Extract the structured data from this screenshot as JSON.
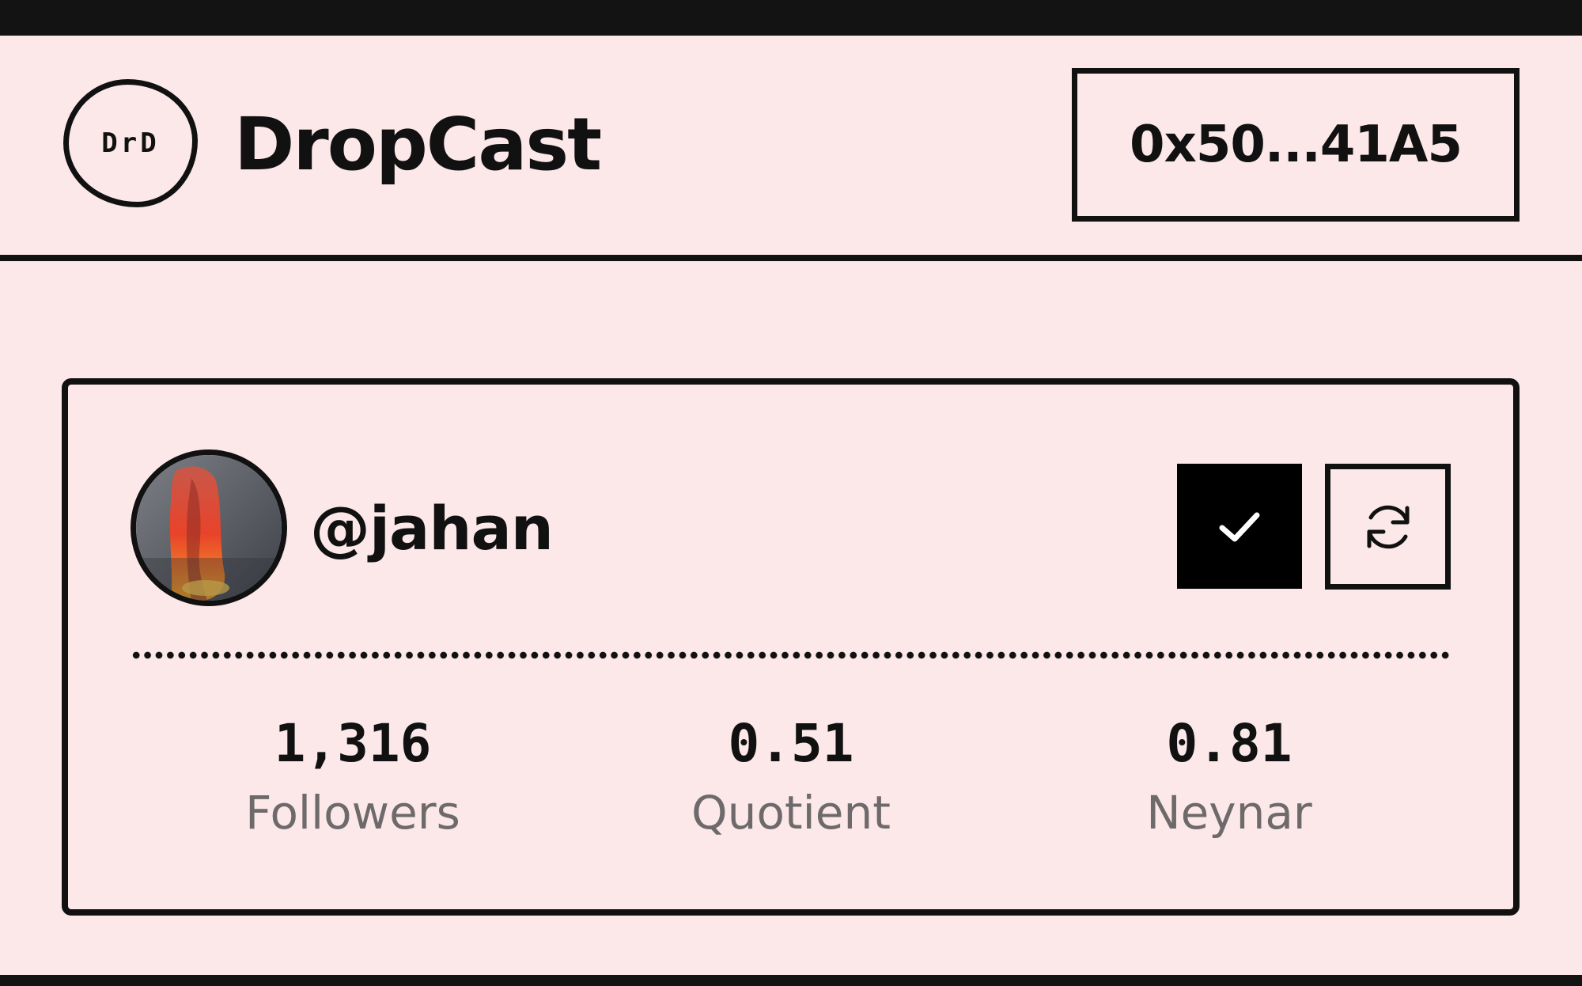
{
  "brand": {
    "logo_text": "DrD",
    "name": "DropCast"
  },
  "wallet": {
    "address": "0x50...41A5"
  },
  "profile": {
    "username": "@jahan",
    "stats": [
      {
        "value": "1,316",
        "label": "Followers"
      },
      {
        "value": "0.51",
        "label": "Quotient"
      },
      {
        "value": "0.81",
        "label": "Neynar"
      }
    ]
  },
  "icons": {
    "logo": "dropcast-logo-icon",
    "avatar": "avatar-image",
    "check": "check-icon",
    "refresh": "refresh-icon"
  },
  "colors": {
    "background": "#fce8e9",
    "ink": "#111111",
    "muted_text": "#6e6a6b",
    "chrome_bar": "#141314"
  }
}
